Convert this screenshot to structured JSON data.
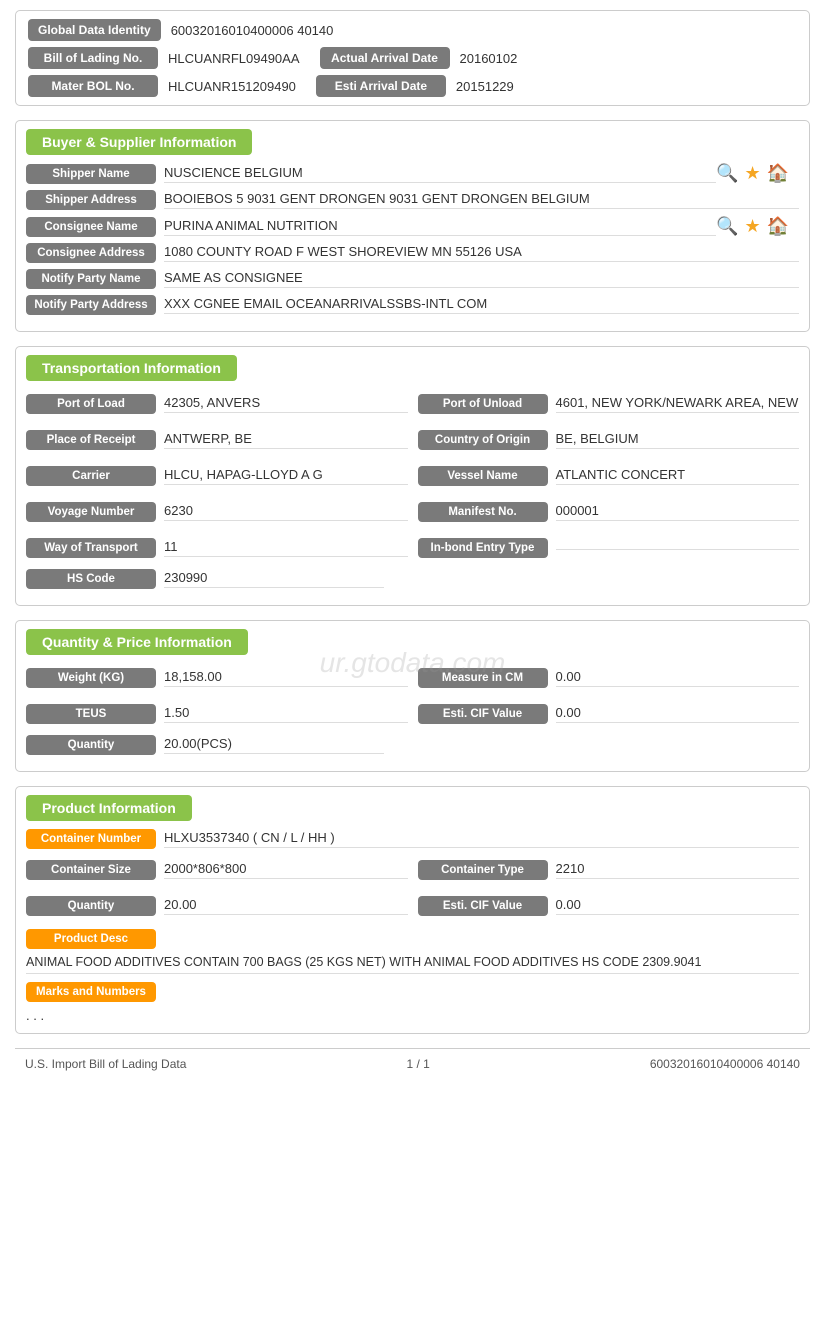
{
  "identity": {
    "global_data_identity_label": "Global Data Identity",
    "global_data_identity_value": "60032016010400006 40140",
    "bill_of_lading_label": "Bill of Lading No.",
    "bill_of_lading_value": "HLCUANRFL09490AA",
    "actual_arrival_date_label": "Actual Arrival Date",
    "actual_arrival_date_value": "20160102",
    "mater_bol_label": "Mater BOL No.",
    "mater_bol_value": "HLCUANR151209490",
    "esti_arrival_date_label": "Esti Arrival Date",
    "esti_arrival_date_value": "20151229"
  },
  "buyer_supplier": {
    "section_label": "Buyer & Supplier Information",
    "shipper_name_label": "Shipper Name",
    "shipper_name_value": "NUSCIENCE BELGIUM",
    "shipper_address_label": "Shipper Address",
    "shipper_address_value": "BOOIEBOS 5 9031 GENT DRONGEN 9031 GENT DRONGEN BELGIUM",
    "consignee_name_label": "Consignee Name",
    "consignee_name_value": "PURINA ANIMAL NUTRITION",
    "consignee_address_label": "Consignee Address",
    "consignee_address_value": "1080 COUNTY ROAD F WEST SHOREVIEW MN 55126 USA",
    "notify_party_name_label": "Notify Party Name",
    "notify_party_name_value": "SAME AS CONSIGNEE",
    "notify_party_address_label": "Notify Party Address",
    "notify_party_address_value": "XXX CGNEE EMAIL OCEANARRIVALSSBS-INTL COM"
  },
  "transportation": {
    "section_label": "Transportation Information",
    "port_of_load_label": "Port of Load",
    "port_of_load_value": "42305, ANVERS",
    "port_of_unload_label": "Port of Unload",
    "port_of_unload_value": "4601, NEW YORK/NEWARK AREA, NEW",
    "place_of_receipt_label": "Place of Receipt",
    "place_of_receipt_value": "ANTWERP, BE",
    "country_of_origin_label": "Country of Origin",
    "country_of_origin_value": "BE, BELGIUM",
    "carrier_label": "Carrier",
    "carrier_value": "HLCU, HAPAG-LLOYD A G",
    "vessel_name_label": "Vessel Name",
    "vessel_name_value": "ATLANTIC CONCERT",
    "voyage_number_label": "Voyage Number",
    "voyage_number_value": "6230",
    "manifest_no_label": "Manifest No.",
    "manifest_no_value": "000001",
    "way_of_transport_label": "Way of Transport",
    "way_of_transport_value": "11",
    "in_bond_entry_type_label": "In-bond Entry Type",
    "in_bond_entry_type_value": "",
    "hs_code_label": "HS Code",
    "hs_code_value": "230990"
  },
  "quantity_price": {
    "section_label": "Quantity & Price Information",
    "weight_kg_label": "Weight (KG)",
    "weight_kg_value": "18,158.00",
    "measure_in_cm_label": "Measure in CM",
    "measure_in_cm_value": "0.00",
    "teus_label": "TEUS",
    "teus_value": "1.50",
    "esti_cif_value_label": "Esti. CIF Value",
    "esti_cif_value_1": "0.00",
    "quantity_label": "Quantity",
    "quantity_value": "20.00(PCS)"
  },
  "product_information": {
    "section_label": "Product Information",
    "container_number_label": "Container Number",
    "container_number_value": "HLXU3537340 ( CN / L / HH )",
    "container_size_label": "Container Size",
    "container_size_value": "2000*806*800",
    "container_type_label": "Container Type",
    "container_type_value": "2210",
    "quantity_label": "Quantity",
    "quantity_value": "20.00",
    "esti_cif_value_label": "Esti. CIF Value",
    "esti_cif_value": "0.00",
    "product_desc_label": "Product Desc",
    "product_desc_value": "ANIMAL FOOD ADDITIVES CONTAIN 700 BAGS (25 KGS NET) WITH ANIMAL FOOD ADDITIVES HS CODE 2309.9041",
    "marks_and_numbers_label": "Marks and Numbers",
    "marks_and_numbers_value": ". . ."
  },
  "footer": {
    "left": "U.S. Import Bill of Lading Data",
    "center": "1 / 1",
    "right": "60032016010400006 40140"
  },
  "watermark": "ur.gtodata.com"
}
